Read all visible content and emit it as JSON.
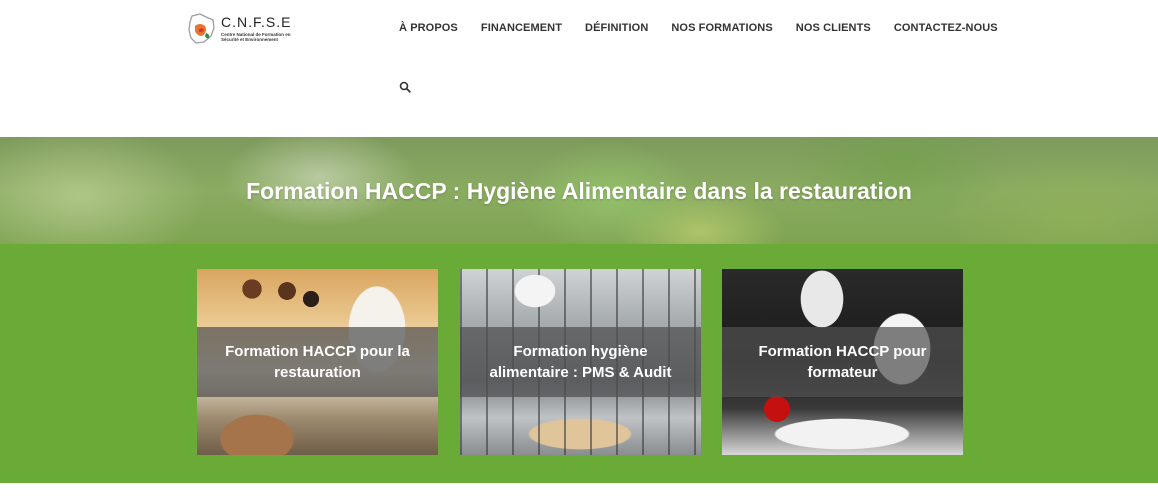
{
  "logo": {
    "title": "C.N.F.S.E",
    "subtitle": "Centre National de Formation en Sécurité et Environnement"
  },
  "nav": {
    "items": [
      {
        "label": "À PROPOS"
      },
      {
        "label": "FINANCEMENT"
      },
      {
        "label": "DÉFINITION"
      },
      {
        "label": "NOS FORMATIONS"
      },
      {
        "label": "NOS CLIENTS"
      },
      {
        "label": "CONTACTEZ-NOUS"
      }
    ],
    "search_icon": "search-icon"
  },
  "banner": {
    "title_bold": "Formation HACCP",
    "title_rest": " : Hygiène Alimentaire dans la restauration"
  },
  "cards": [
    {
      "title": "Formation HACCP pour la restauration"
    },
    {
      "title": "Formation hygiène alimentaire : PMS & Audit"
    },
    {
      "title": "Formation HACCP pour formateur"
    }
  ],
  "colors": {
    "section_green": "#6aaa36",
    "nav_text": "#333333"
  }
}
